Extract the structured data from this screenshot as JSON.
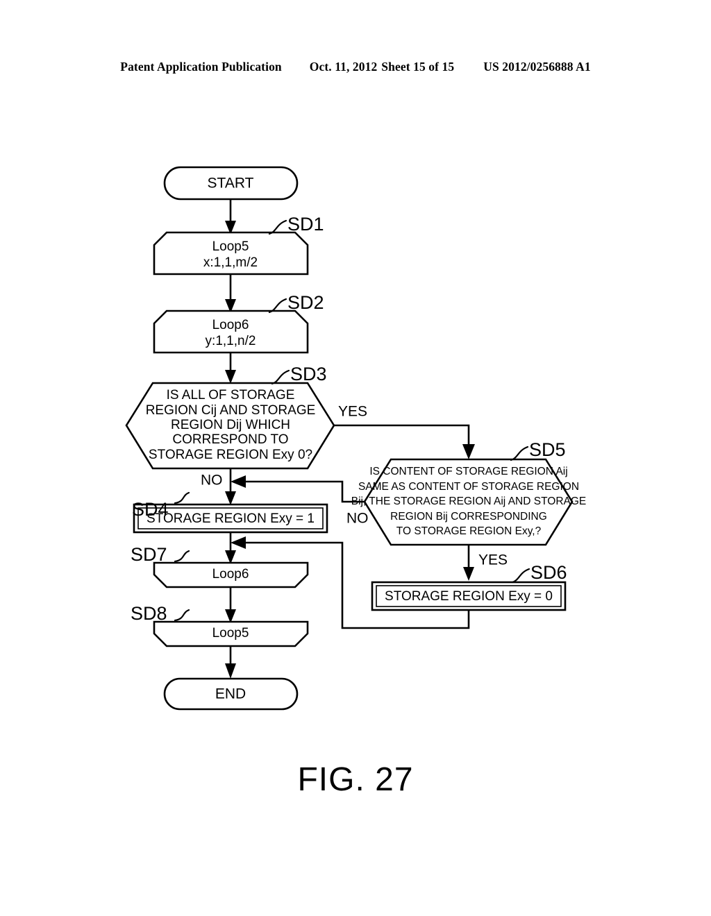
{
  "header": {
    "publication": "Patent Application Publication",
    "date": "Oct. 11, 2012",
    "sheet": "Sheet 15 of 15",
    "patent_number": "US 2012/0256888 A1"
  },
  "figure": {
    "caption": "FIG. 27"
  },
  "flowchart": {
    "nodes": {
      "start": {
        "label": "START",
        "shape": "terminator"
      },
      "sd1": {
        "step": "SD1",
        "shape": "loop-start",
        "line1": "Loop5",
        "line2": "x:1,1,m/2"
      },
      "sd2": {
        "step": "SD2",
        "shape": "loop-start",
        "line1": "Loop6",
        "line2": "y:1,1,n/2"
      },
      "sd3": {
        "step": "SD3",
        "shape": "decision-hexagon",
        "lines": [
          "IS ALL OF STORAGE",
          "REGION Cij AND STORAGE",
          "REGION Dij WHICH",
          "CORRESPOND TO",
          "STORAGE REGION Exy 0?"
        ]
      },
      "sd4": {
        "step": "SD4",
        "shape": "process",
        "label": "STORAGE REGION Exy = 1"
      },
      "sd5": {
        "step": "SD5",
        "shape": "decision-hexagon",
        "lines": [
          "IS CONTENT OF STORAGE REGION Aij",
          "SAME AS CONTENT OF STORAGE REGION",
          "Bij, THE STORAGE REGION Aij AND STORAGE",
          "REGION Bij CORRESPONDING",
          "TO STORAGE REGION Exy,?"
        ]
      },
      "sd6": {
        "step": "SD6",
        "shape": "process",
        "label": "STORAGE REGION Exy = 0"
      },
      "sd7": {
        "step": "SD7",
        "shape": "loop-end",
        "label": "Loop6"
      },
      "sd8": {
        "step": "SD8",
        "shape": "loop-end",
        "label": "Loop5"
      },
      "end": {
        "label": "END",
        "shape": "terminator"
      }
    },
    "branch_labels": {
      "sd3_yes": "YES",
      "sd3_no": "NO",
      "sd5_no": "NO",
      "sd5_yes": "YES"
    }
  }
}
